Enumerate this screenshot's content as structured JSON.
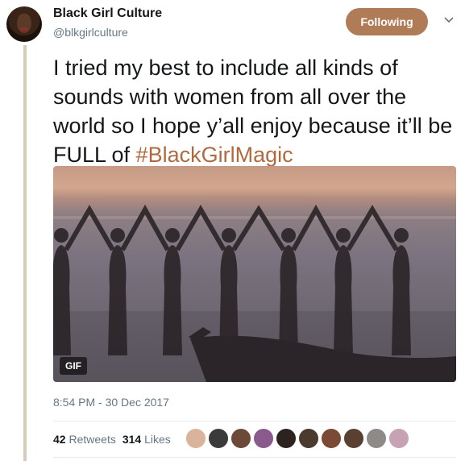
{
  "user": {
    "name": "Black Girl Culture",
    "handle": "@blkgirlculture"
  },
  "follow_button": {
    "label": "Following"
  },
  "tweet": {
    "text": "I tried my best to include all kinds of sounds with women from all over the world so I hope y’all enjoy because it’ll be FULL of ",
    "hashtag": "#BlackGirlMagic"
  },
  "media": {
    "badge": "GIF"
  },
  "timestamp": "8:54 PM - 30 Dec 2017",
  "stats": {
    "retweets_count": "42",
    "retweets_label": "Retweets",
    "likes_count": "314",
    "likes_label": "Likes"
  },
  "likers": {
    "colors": [
      "#d9b39a",
      "#3b3b3b",
      "#6b4a3a",
      "#8a5a8c",
      "#2c2320",
      "#4b3a2e",
      "#7a4a35",
      "#5a4030",
      "#8e8a87",
      "#c7a1b4"
    ]
  },
  "colors": {
    "accent": "#b07c57",
    "hashtag": "#b06a3f",
    "thread_line": "#dcc8b6"
  }
}
